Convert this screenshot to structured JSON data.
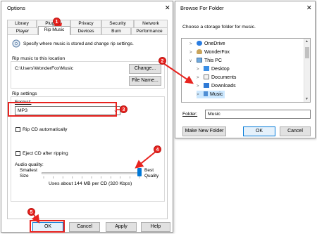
{
  "options": {
    "title": "Options",
    "close": "✕",
    "tabs_row1": [
      "Library",
      "Plug-ins",
      "Privacy",
      "Security",
      "Network"
    ],
    "tabs_row2": [
      "Player",
      "Rip Music",
      "Devices",
      "Burn",
      "Performance"
    ],
    "active_tab": "Rip Music",
    "description": "Specify where music is stored and change rip settings.",
    "rip_location_label": "Rip music to this location",
    "rip_location_path": "C:\\Users\\WonderFox\\Music",
    "change_button": "Change...",
    "filename_button": "File Name...",
    "rip_settings_label": "Rip settings",
    "format_label": "Format:",
    "format_value": "MP3",
    "rip_auto_label": "Rip CD automatically",
    "eject_label": "Eject CD after ripping",
    "audio_quality_label": "Audio quality:",
    "smallest_size": "Smallest Size",
    "best_quality": "Best Quality",
    "quality_level": 1.0,
    "usage_text": "Uses about 144 MB per CD (320 Kbps)",
    "ok": "OK",
    "cancel": "Cancel",
    "apply": "Apply",
    "help": "Help"
  },
  "browse": {
    "title": "Browse For Folder",
    "close": "✕",
    "prompt": "Choose a storage folder for music.",
    "tree": [
      "OneDrive",
      "WonderFox",
      "This PC",
      "Desktop",
      "Documents",
      "Downloads",
      "Music"
    ],
    "selected": "Music",
    "folder_label": "Folder:",
    "folder_value": "Music",
    "make_new_folder": "Make New Folder",
    "ok": "OK",
    "cancel": "Cancel"
  },
  "callouts": [
    "1",
    "2",
    "3",
    "4",
    "5"
  ],
  "colors": {
    "callout_red": "#e8231f",
    "accent_blue": "#0078d7",
    "folder_yellow": "#e8b64a"
  }
}
